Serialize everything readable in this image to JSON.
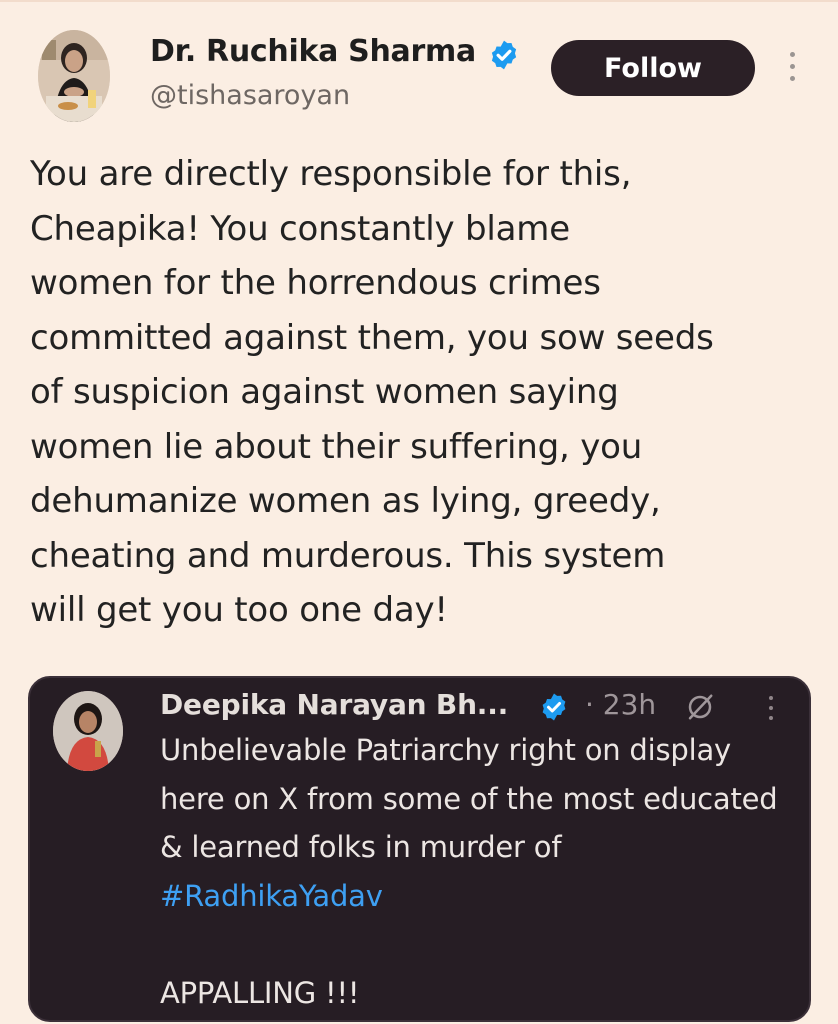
{
  "tweet": {
    "author": {
      "name": "Dr. Ruchika Sharma",
      "handle": "@tishasaroyan",
      "verified": true
    },
    "follow_label": "Follow",
    "text": "You are directly responsible for this,\nCheapika! You constantly blame\nwomen for the horrendous crimes\ncommitted against them, you sow seeds\nof suspicion against women saying\nwomen lie about their suffering, you\ndehumanize women as lying, greedy,\ncheating and murderous. This system\nwill get you too one day!"
  },
  "quoted_tweet": {
    "author": {
      "name": "Deepika Narayan Bh...",
      "verified": true
    },
    "time": "· 23h",
    "text_before_hashtag": "Unbelievable Patriarchy right on display here on X from some of the most educated & learned folks in murder of ",
    "hashtag": "#RadhikaYadav",
    "text_after": "APPALLING !!!"
  },
  "colors": {
    "background": "#fbeee3",
    "verified_badge": "#1d9bf0",
    "hashtag": "#3ea0f3",
    "follow_button": "#2b2026",
    "quote_card": "#261d24"
  },
  "icons": {
    "main_verified": "verified-badge-icon",
    "main_more": "more-options-icon",
    "quote_verified": "verified-badge-icon",
    "quote_grok": "grok-icon",
    "quote_more": "more-options-icon"
  }
}
